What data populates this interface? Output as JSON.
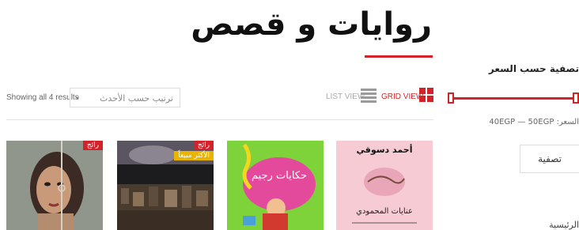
{
  "page": {
    "title": "روايات و قصص"
  },
  "toolbar": {
    "results_text": "Showing all 4 results",
    "sort_label": "ترتيب حسب الأحدث",
    "list_view_label": "LIST VIEW",
    "grid_view_label": "GRID VIEW"
  },
  "filter": {
    "title": "تصفية حسب السعر",
    "price_text": "السعر: 40EGP — 50EGP",
    "button_label": "تصفية",
    "min_fraction": 0,
    "max_fraction": 1
  },
  "sidebar": {
    "home_label": "الرئيسية"
  },
  "products": [
    {
      "badge": "رائج",
      "badge2": ""
    },
    {
      "badge": "رائج",
      "badge2": "الأكثر مبيعاً"
    },
    {
      "badge": "",
      "badge2": ""
    },
    {
      "badge": "",
      "badge2": ""
    }
  ],
  "covers": {
    "book3_title": "حكايات رجيم",
    "book4_author": "أحمد دسوقي",
    "book4_title": "عنايات المحمودي"
  },
  "colors": {
    "accent": "#d3232a",
    "badge_yellow": "#e8b400"
  }
}
